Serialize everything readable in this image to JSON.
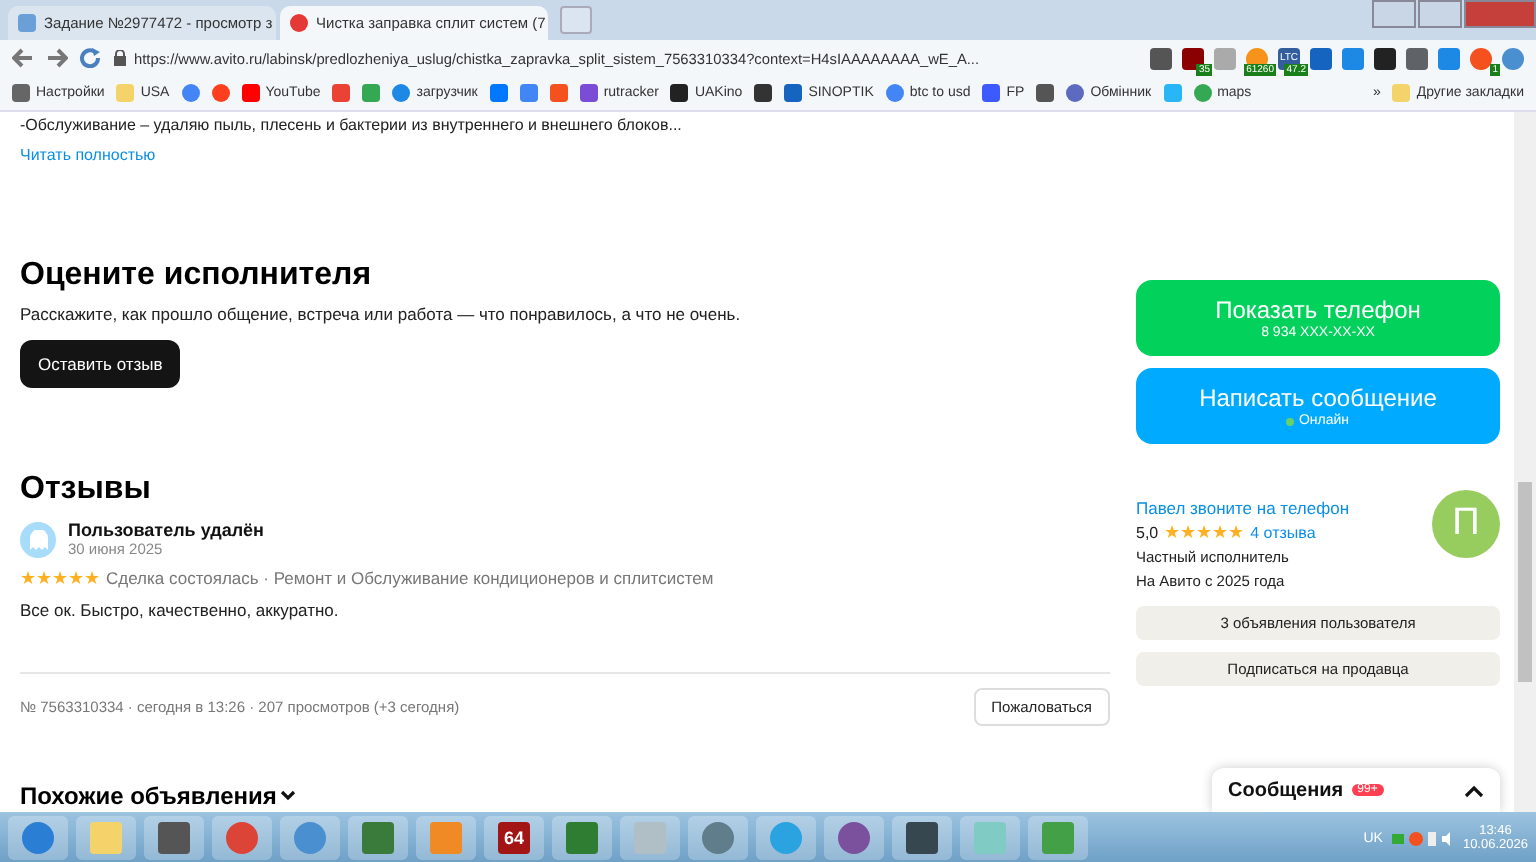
{
  "browser": {
    "tabs": [
      {
        "title": "Задание №2977472 - просмотр з",
        "selected": false
      },
      {
        "title": "Чистка заправка сплит систем (7",
        "selected": true
      }
    ],
    "url": "https://www.avito.ru/labinsk/predlozheniya_uslug/chistka_zapravka_split_sistem_7563310334?context=H4sIAAAAAAAA_wE_A...",
    "extensions": [
      {
        "kind": "icon"
      },
      {
        "kind": "badge",
        "badge": "35"
      },
      {
        "kind": "icon"
      },
      {
        "kind": "badge",
        "badge": "61260"
      },
      {
        "kind": "badge",
        "label": "LTC",
        "badge": "47.2"
      },
      {
        "kind": "icon"
      },
      {
        "kind": "icon"
      },
      {
        "kind": "icon"
      },
      {
        "kind": "icon"
      },
      {
        "kind": "icon"
      },
      {
        "kind": "badge",
        "badge": "1"
      },
      {
        "kind": "icon"
      }
    ],
    "bookmarks": [
      {
        "kind": "link",
        "label": "Настройки"
      },
      {
        "kind": "link",
        "label": "USA"
      },
      {
        "kind": "icon"
      },
      {
        "kind": "icon"
      },
      {
        "kind": "link",
        "label": "YouTube"
      },
      {
        "kind": "icon"
      },
      {
        "kind": "icon"
      },
      {
        "kind": "link",
        "label": "загрузчик"
      },
      {
        "kind": "icon"
      },
      {
        "kind": "icon"
      },
      {
        "kind": "icon"
      },
      {
        "kind": "link",
        "label": "rutracker"
      },
      {
        "kind": "link",
        "label": "UAKino"
      },
      {
        "kind": "icon"
      },
      {
        "kind": "link",
        "label": "SINOPTIK"
      },
      {
        "kind": "link",
        "label": "btc to usd"
      },
      {
        "kind": "link",
        "label": "FP"
      },
      {
        "kind": "icon"
      },
      {
        "kind": "link",
        "label": "Обмінник"
      },
      {
        "kind": "icon"
      },
      {
        "kind": "link",
        "label": "maps"
      }
    ],
    "more": "»",
    "other_bookmarks": "Другие закладки"
  },
  "page": {
    "cut_text": "-Обслуживание – удаляю пыль, плесень и бактерии из внутреннего и внешнего блоков...",
    "read_more": "Читать полностью",
    "rate": {
      "title": "Оцените исполнителя",
      "text": "Расскажите, как прошло общение, встреча или работа — что понравилось, а что не очень.",
      "button": "Оставить отзыв"
    },
    "reviews": {
      "title": "Отзывы",
      "items": [
        {
          "author": "Пользователь удалён",
          "date": "30 июня 2025",
          "stars": 5,
          "meta": "Сделка состоялась · Ремонт и Обслуживание кондиционеров и сплитсистем",
          "text": "Все ок. Быстро, качественно, аккуратно."
        }
      ]
    },
    "footer": {
      "info": "№ 7563310334 · сегодня в 13:26 · 207 просмотров (+3 сегодня)",
      "report": "Пожаловаться"
    },
    "similar": "Похожие объявления",
    "contact": {
      "call_title": "Показать телефон",
      "call_sub": "8 934 XXX-XX-XX",
      "msg_title": "Написать сообщение",
      "online": "Онлайн"
    },
    "seller": {
      "name": "Павел звоните на телефон",
      "rating": "5,0",
      "stars": 5,
      "reviews": "4 отзыва",
      "type": "Частный исполнитель",
      "since": "На Авито с 2025 года",
      "avatar": "П",
      "ads": "3 объявления пользователя",
      "subscribe": "Подписаться на продавца"
    },
    "messages": {
      "title": "Сообщения",
      "badge": "99+"
    }
  },
  "taskbar": {
    "apps": [
      {
        "kind": "icon"
      },
      {
        "kind": "icon"
      },
      {
        "kind": "icon"
      },
      {
        "kind": "icon"
      },
      {
        "kind": "icon"
      },
      {
        "kind": "icon"
      },
      {
        "kind": "icon"
      },
      {
        "kind": "text",
        "label": "64"
      },
      {
        "kind": "icon"
      },
      {
        "kind": "icon"
      },
      {
        "kind": "icon"
      },
      {
        "kind": "icon"
      },
      {
        "kind": "icon"
      },
      {
        "kind": "icon"
      },
      {
        "kind": "icon"
      },
      {
        "kind": "icon"
      }
    ],
    "lang": "UK",
    "time": "13:46",
    "date": "10.06.2026"
  }
}
